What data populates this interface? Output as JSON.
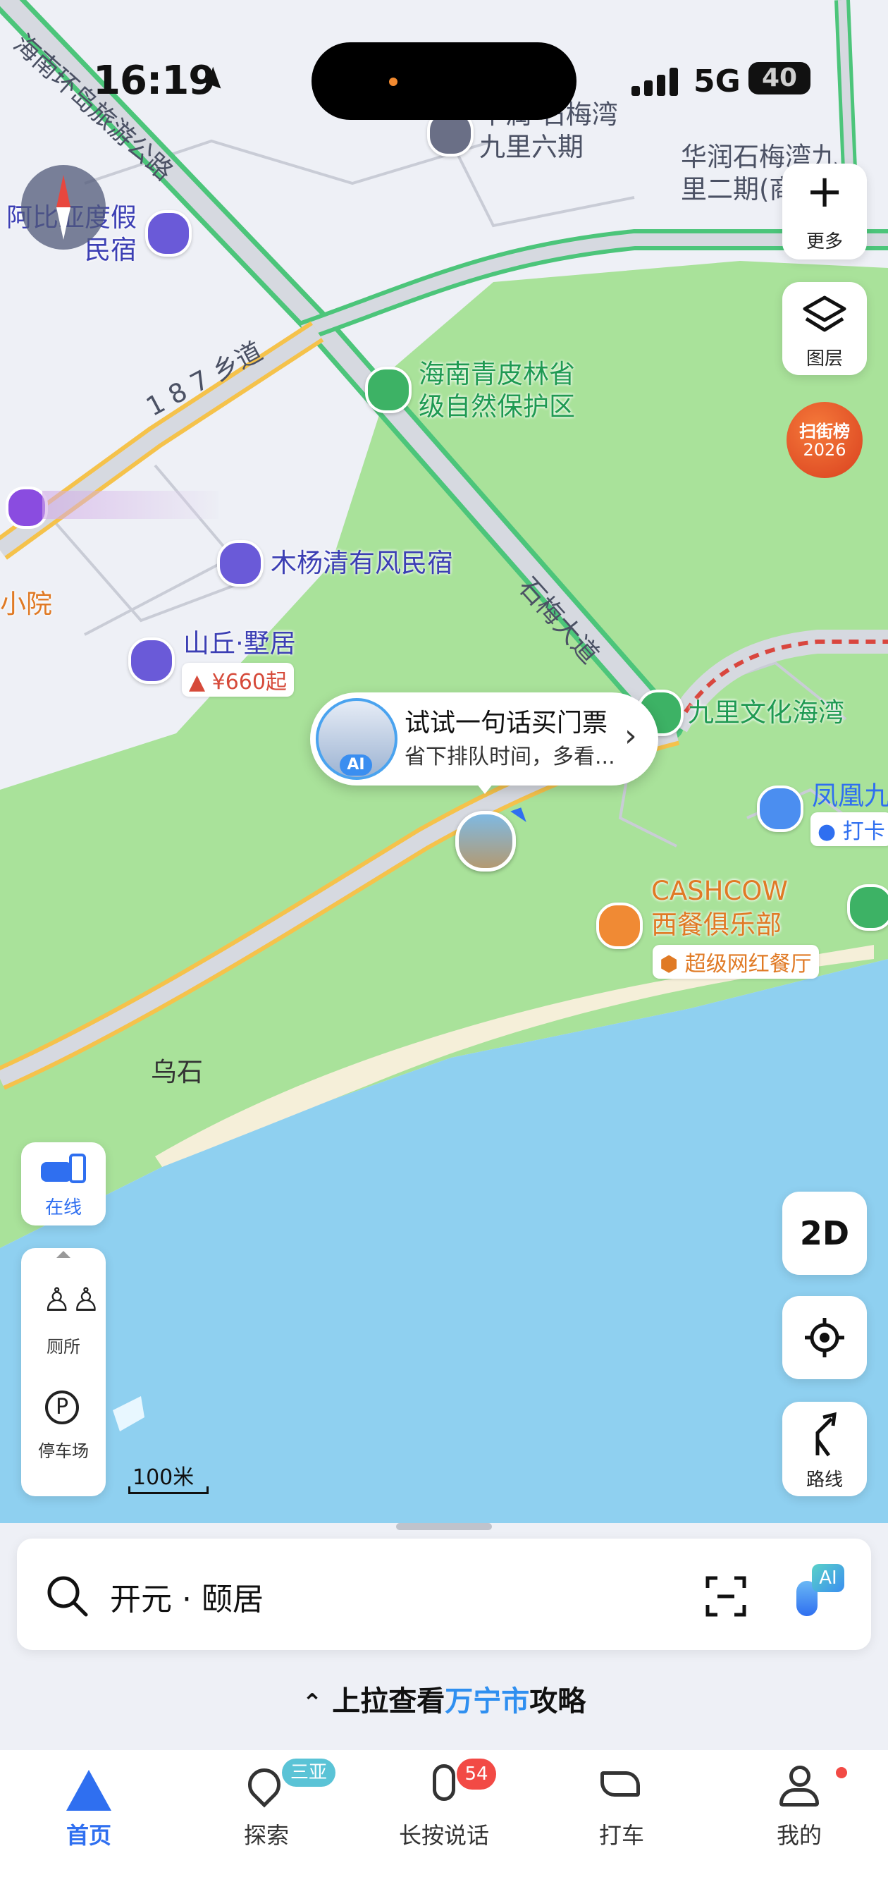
{
  "status_bar": {
    "time": "16:19",
    "network": "5G",
    "battery": "40"
  },
  "map": {
    "labels": {
      "hainan_road": "海南环岛旅游公路",
      "shimei_a": "华润·石梅湾",
      "shimei_b": "九里六期",
      "huarun_a": "华润石梅湾九",
      "huarun_b": "里二期(商",
      "abi_a": "阿比亚度假",
      "abi_b": "民宿",
      "xiang_road": "1 8 7 乡道",
      "reserve_a": "海南青皮林省",
      "reserve_b": "级自然保护区",
      "muyang": "木杨清有风民宿",
      "xiaoyuan": "小院",
      "shanqiu": "山丘·墅居",
      "shanqiu_price": "¥660起",
      "shimei_road": "石梅大道",
      "jiuli": "九里文化海湾",
      "fenghuang": "凤凰九",
      "daka": "打卡",
      "cashcow_a": "CASHCOW",
      "cashcow_b": "西餐俱乐部",
      "cashcow_tag": "超级网红餐厅",
      "wushi": "乌石",
      "scale": "100米"
    }
  },
  "right_controls": {
    "more": "更多",
    "layers": "图层",
    "badge_a": "扫街榜",
    "badge_b": "2026",
    "mode_2d": "2D",
    "route": "路线"
  },
  "left_controls": {
    "online": "在线",
    "toilet": "厕所",
    "parking": "停车场"
  },
  "ai_bubble": {
    "avatar_tag": "AI",
    "title": "试试一句话买门票",
    "subtitle": "省下排队时间，多看..."
  },
  "search": {
    "value": "开元 · 颐居",
    "ai_tag": "AI"
  },
  "guide": {
    "prefix": "上拉查看",
    "city": "万宁市",
    "suffix": "攻略"
  },
  "tabbar": {
    "home": "首页",
    "explore": "探索",
    "explore_badge": "三亚",
    "voice": "长按说话",
    "voice_badge": "54",
    "taxi": "打车",
    "mine": "我的"
  },
  "colors": {
    "accent": "#2f6ff0",
    "land": "#a9e29a",
    "water": "#8fd0f0",
    "road_green": "#4cc57a",
    "road_yellow": "#f5c24b",
    "poi_purple": "#6a5ad8",
    "orange": "#f08a34",
    "red_badge": "#f24a45"
  }
}
